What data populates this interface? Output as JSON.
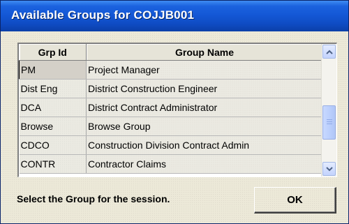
{
  "window": {
    "title": "Available Groups for COJJB001"
  },
  "grid": {
    "columns": [
      "Grp Id",
      "Group Name"
    ],
    "rows": [
      [
        "PM",
        "Project Manager"
      ],
      [
        "Dist Eng",
        "District Construction Engineer"
      ],
      [
        "DCA",
        "District Contract Administrator"
      ],
      [
        "Browse",
        "Browse Group"
      ],
      [
        "CDCO",
        "Construction Division Contract Admin"
      ],
      [
        "CONTR",
        "Contractor Claims"
      ]
    ]
  },
  "footer": {
    "prompt": "Select the Group for the session.",
    "ok_label": "OK"
  },
  "icons": {
    "scroll_up": "chevron-up-icon",
    "scroll_down": "chevron-down-icon"
  }
}
